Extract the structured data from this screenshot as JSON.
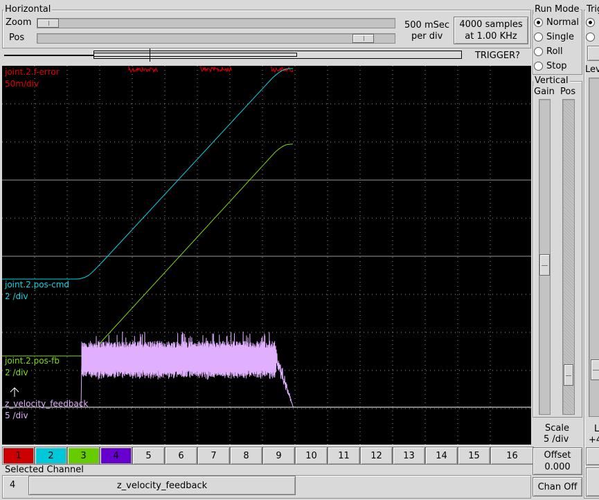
{
  "horizontal": {
    "title": "Horizontal",
    "zoom_label": "Zoom",
    "pos_label": "Pos",
    "time_per_div": "500 mSec",
    "per_div": "per div",
    "samples_line1": "4000 samples",
    "samples_line2": "at 1.00 KHz",
    "trigger_button": "TRIGGER?"
  },
  "run_mode": {
    "title": "Run Mode",
    "options": [
      "Normal",
      "Single",
      "Roll",
      "Stop"
    ],
    "selected": "Normal"
  },
  "trigger": {
    "title": "Trig",
    "level_label": "Lev"
  },
  "vertical": {
    "title": "Vertical",
    "gain_label": "Gain",
    "pos_label": "Pos",
    "scale_label": "Scale",
    "scale_value": "5 /div",
    "offset_label": "Offset",
    "offset_value": "0.000",
    "chan_off_button": "Chan Off",
    "right_partial_1": "L",
    "right_partial_2": "+4"
  },
  "traces": [
    {
      "name": "joint.2.f-error",
      "scale": "50m/div",
      "color": "#e00000"
    },
    {
      "name": "joint.2.pos-cmd",
      "scale": "2 /div",
      "color": "#00d8e8"
    },
    {
      "name": "joint.2.pos-fb",
      "scale": "2 /div",
      "color": "#7ee000"
    },
    {
      "name": "z_velocity_feedback",
      "scale": "5 /div",
      "color": "#e0b0ff"
    }
  ],
  "channels": [
    {
      "label": "1",
      "color": "#cc0000"
    },
    {
      "label": "2",
      "color": "#00c8d8"
    },
    {
      "label": "3",
      "color": "#66cc00"
    },
    {
      "label": "4",
      "color": "#6600cc"
    },
    {
      "label": "5",
      "color": "#d9d9d9"
    },
    {
      "label": "6",
      "color": "#d9d9d9"
    },
    {
      "label": "7",
      "color": "#d9d9d9"
    },
    {
      "label": "8",
      "color": "#d9d9d9"
    },
    {
      "label": "9",
      "color": "#d9d9d9"
    },
    {
      "label": "10",
      "color": "#d9d9d9"
    },
    {
      "label": "11",
      "color": "#d9d9d9"
    },
    {
      "label": "12",
      "color": "#d9d9d9"
    },
    {
      "label": "13",
      "color": "#d9d9d9"
    },
    {
      "label": "14",
      "color": "#d9d9d9"
    },
    {
      "label": "15",
      "color": "#d9d9d9"
    },
    {
      "label": "16",
      "color": "#d9d9d9"
    }
  ],
  "selected_channel": {
    "title": "Selected Channel",
    "number": "4",
    "name": "z_velocity_feedback"
  }
}
